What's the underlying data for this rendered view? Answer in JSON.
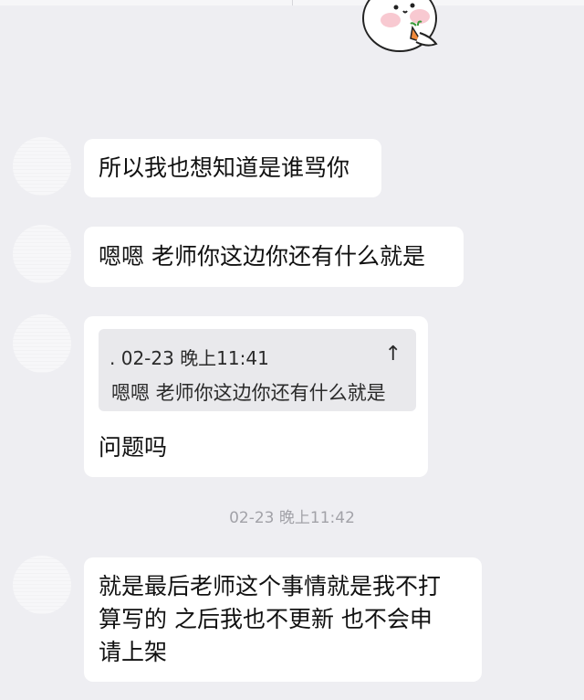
{
  "messages": [
    {
      "text": "所以我也想知道是谁骂你"
    },
    {
      "text": "嗯嗯 老师你这边你还有什么就是"
    },
    {
      "quote": {
        "meta": ". 02-23 晚上11:41",
        "arrow": "↑",
        "text": "嗯嗯 老师你这边你还有什么就是"
      },
      "text": "问题吗"
    },
    {
      "text": "就是最后老师这个事情就是我不打\n算写的 之后我也不更新 也不会申\n请上架"
    }
  ],
  "timestamp": "02-23 晚上11:42",
  "icons": {
    "sticker": "carrot-ghost-sticker",
    "quote_arrow": "up-arrow-icon"
  },
  "colors": {
    "background": "#eeeef2",
    "bubble": "#ffffff",
    "quote_box": "#e9e9ec",
    "timestamp": "#a2a2a8"
  }
}
